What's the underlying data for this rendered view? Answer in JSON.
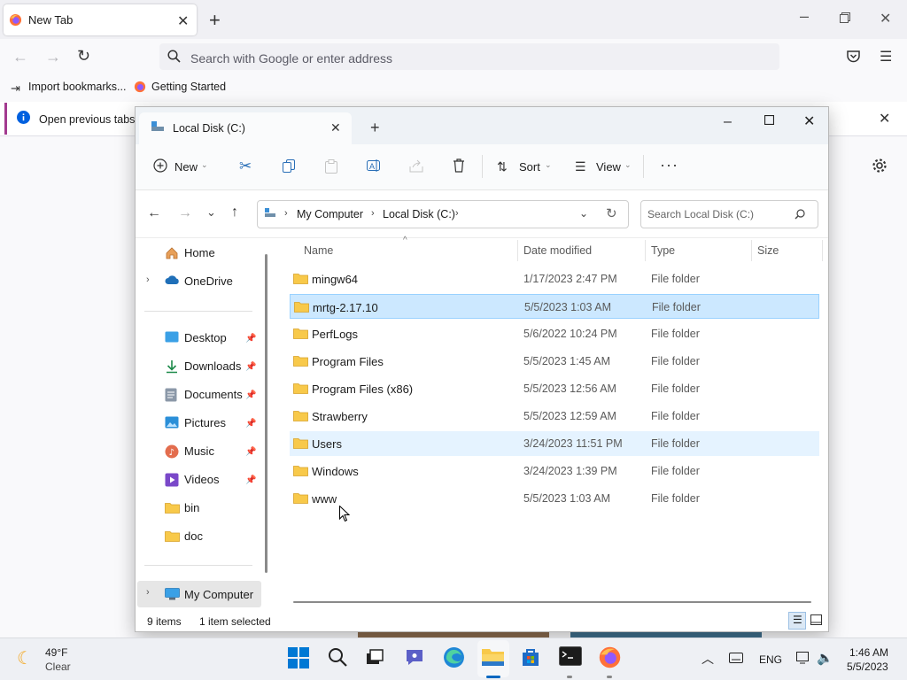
{
  "browser": {
    "tab_title": "New Tab",
    "url_placeholder": "Search with Google or enter address",
    "bookmarks": [
      "Import bookmarks...",
      "Getting Started"
    ],
    "notification_text": "Open previous tabs?"
  },
  "explorer": {
    "tab_title": "Local Disk (C:)",
    "toolbar": {
      "new_label": "New",
      "sort_label": "Sort",
      "view_label": "View"
    },
    "breadcrumb": [
      "My Computer",
      "Local Disk (C:)"
    ],
    "search_placeholder": "Search Local Disk (C:)",
    "columns": [
      "Name",
      "Date modified",
      "Type",
      "Size"
    ],
    "nav": {
      "home": "Home",
      "onedrive": "OneDrive",
      "desktop": "Desktop",
      "downloads": "Downloads",
      "documents": "Documents",
      "pictures": "Pictures",
      "music": "Music",
      "videos": "Videos",
      "bin": "bin",
      "doc": "doc",
      "mycomputer": "My Computer"
    },
    "files": [
      {
        "name": "mingw64",
        "date": "1/17/2023 2:47 PM",
        "type": "File folder"
      },
      {
        "name": "mrtg-2.17.10",
        "date": "5/5/2023 1:03 AM",
        "type": "File folder"
      },
      {
        "name": "PerfLogs",
        "date": "5/6/2022 10:24 PM",
        "type": "File folder"
      },
      {
        "name": "Program Files",
        "date": "5/5/2023 1:45 AM",
        "type": "File folder"
      },
      {
        "name": "Program Files (x86)",
        "date": "5/5/2023 12:56 AM",
        "type": "File folder"
      },
      {
        "name": "Strawberry",
        "date": "5/5/2023 12:59 AM",
        "type": "File folder"
      },
      {
        "name": "Users",
        "date": "3/24/2023 11:51 PM",
        "type": "File folder"
      },
      {
        "name": "Windows",
        "date": "3/24/2023 1:39 PM",
        "type": "File folder"
      },
      {
        "name": "www",
        "date": "5/5/2023 1:03 AM",
        "type": "File folder"
      }
    ],
    "status": {
      "items": "9 items",
      "selected": "1 item selected"
    }
  },
  "taskbar": {
    "weather_temp": "49°F",
    "weather_desc": "Clear",
    "language": "ENG",
    "time": "1:46 AM",
    "date": "5/5/2023"
  },
  "colors": {
    "selection": "#cce8ff",
    "hover": "#e5f3ff",
    "folder": "#f8c94a",
    "accent": "#0067c0"
  }
}
